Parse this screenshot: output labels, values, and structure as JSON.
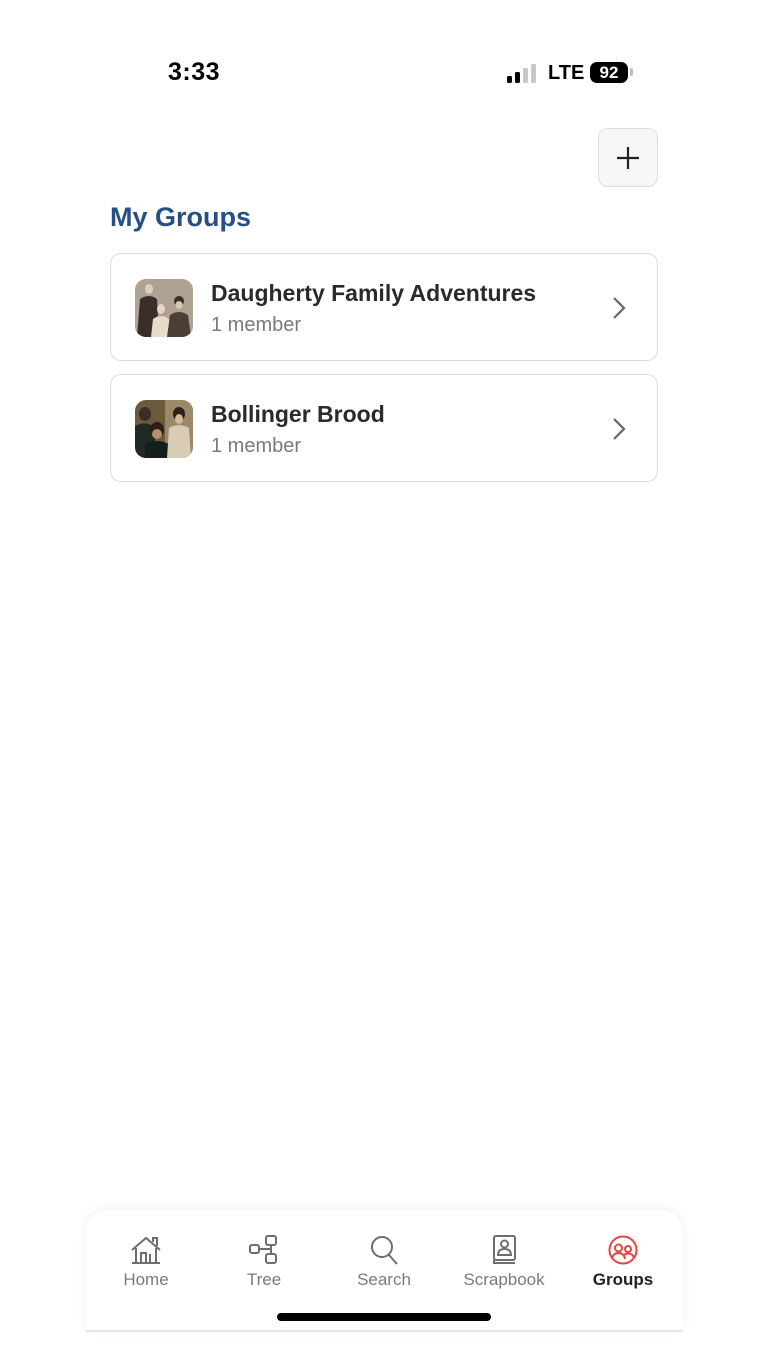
{
  "status_bar": {
    "time": "3:33",
    "network": "LTE",
    "battery": "92",
    "signal_bars_active": 2,
    "signal_bars_total": 4
  },
  "header": {
    "add_button_icon": "plus-icon"
  },
  "page": {
    "title": "My Groups",
    "title_color": "#264f86"
  },
  "groups": [
    {
      "name": "Daugherty Family Adventures",
      "members": "1 member",
      "thumbnail": "sepia-family-photo"
    },
    {
      "name": "Bollinger Brood",
      "members": "1 member",
      "thumbnail": "painted-family-portrait"
    }
  ],
  "tab_bar": {
    "active_color": "#e8453c",
    "tabs": [
      {
        "label": "Home",
        "icon": "home-icon",
        "active": false
      },
      {
        "label": "Tree",
        "icon": "tree-icon",
        "active": false
      },
      {
        "label": "Search",
        "icon": "search-icon",
        "active": false
      },
      {
        "label": "Scrapbook",
        "icon": "scrapbook-icon",
        "active": false
      },
      {
        "label": "Groups",
        "icon": "groups-icon",
        "active": true
      }
    ]
  }
}
